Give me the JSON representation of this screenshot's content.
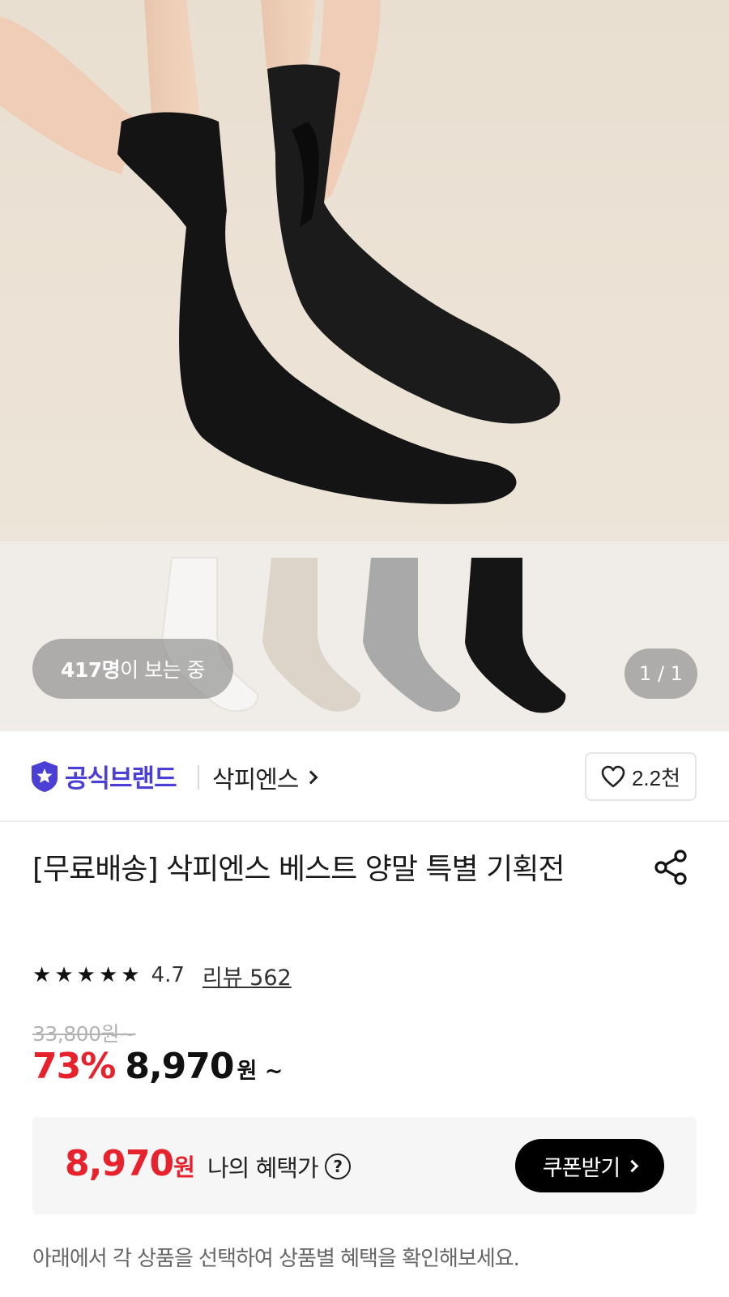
{
  "gallery": {
    "viewers_count": "417명",
    "viewers_suffix": "이 보는 중",
    "page_indicator": "1 / 1"
  },
  "brand": {
    "official_label": "공식브랜드",
    "name": "삭피엔스",
    "likes": "2.2천",
    "accent_color": "#4b3fd6"
  },
  "product": {
    "title": "[무료배송] 삭피엔스 베스트 양말 특별 기획전",
    "rating": "4.7",
    "review_label": "리뷰 562",
    "stars": 4.7,
    "original_price": "33,800원~",
    "discount": "73%",
    "price": "8,970",
    "price_unit": "원 ~",
    "sale_color": "#e8222d"
  },
  "benefit": {
    "price": "8,970",
    "price_unit": "원",
    "label": "나의 혜택가",
    "help_symbol": "?",
    "coupon_label": "쿠폰받기"
  },
  "notice": "아래에서 각 상품을 선택하여 상품별 혜택을 확인해보세요.",
  "icons": [
    "official-brand-star-icon",
    "chevron-right-icon",
    "heart-icon",
    "share-icon",
    "star-icon",
    "help-circle-icon"
  ]
}
